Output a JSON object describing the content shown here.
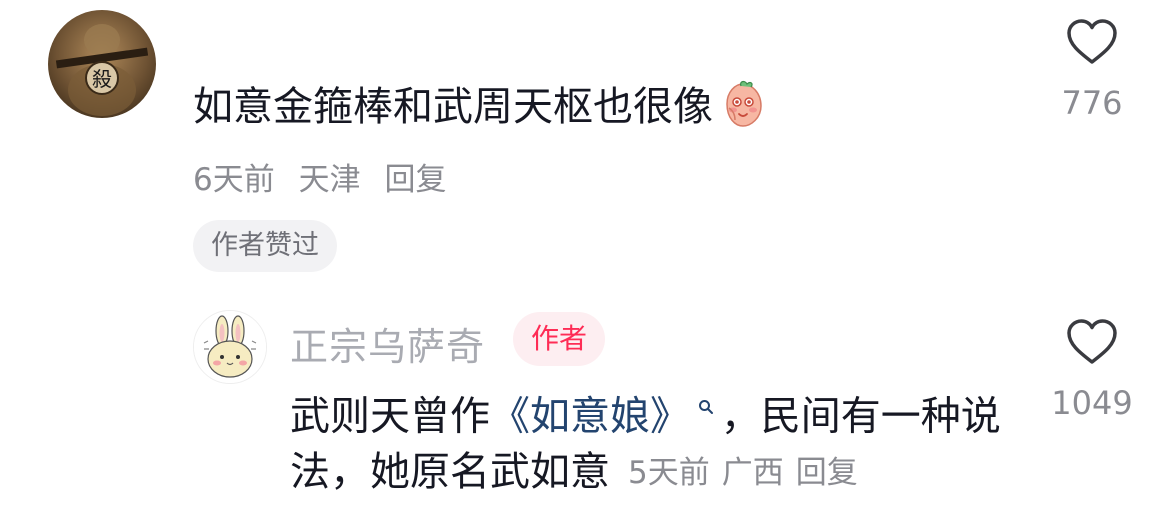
{
  "comment": {
    "text": "如意金箍棒和武周天枢也很像",
    "emoji": "blushing-peach-emoji",
    "time": "6天前",
    "location": "天津",
    "reply_label": "回复",
    "author_liked_label": "作者赞过",
    "avatar_glyph": "殺",
    "like_count": "776"
  },
  "reply": {
    "username": "正宗乌萨奇",
    "author_badge": "作者",
    "text_prefix": "武则天曾作",
    "book_link": "《如意娘》",
    "text_after_link": "，民间有一种说",
    "line2": "法，她原名武如意",
    "time": "5天前",
    "location": "广西",
    "reply_label": "回复",
    "like_count": "1049"
  },
  "colors": {
    "link": "#23446f",
    "author_badge_text": "#fe2c55",
    "author_badge_bg": "#fdeef1",
    "meta_text": "#8a8b91"
  }
}
